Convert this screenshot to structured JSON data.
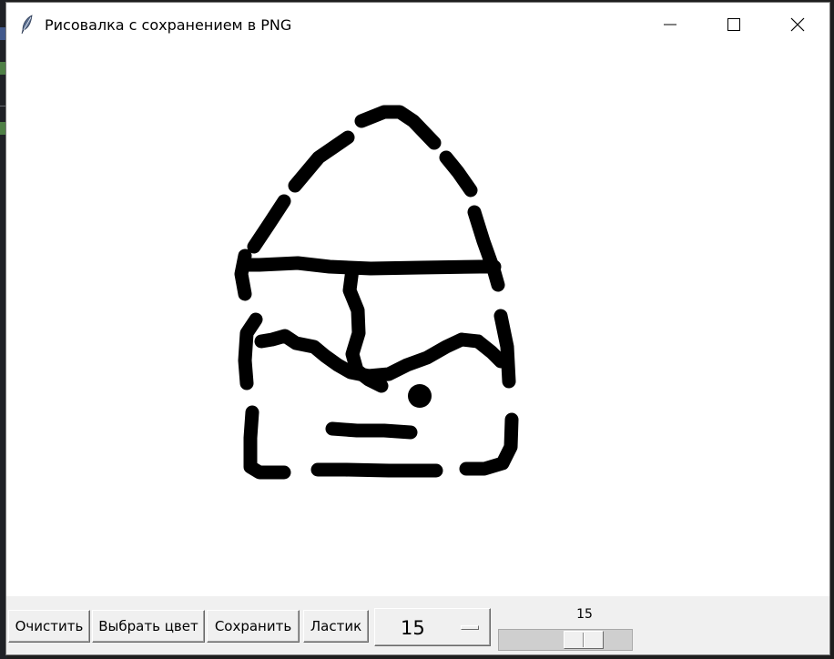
{
  "window": {
    "title": "Рисовалка с сохранением в PNG",
    "icon": "feather-icon",
    "controls": [
      "minimize-icon",
      "maximize-icon",
      "close-icon"
    ]
  },
  "toolbar": {
    "clear_label": "Очистить",
    "color_label": "Выбрать цвет",
    "save_label": "Сохранить",
    "eraser_label": "Ластик",
    "brush_size_selected": "15",
    "scale_value": "15",
    "scale_fraction": 0.7
  },
  "colors": {
    "brush": "#000000",
    "canvas": "#ffffff"
  }
}
